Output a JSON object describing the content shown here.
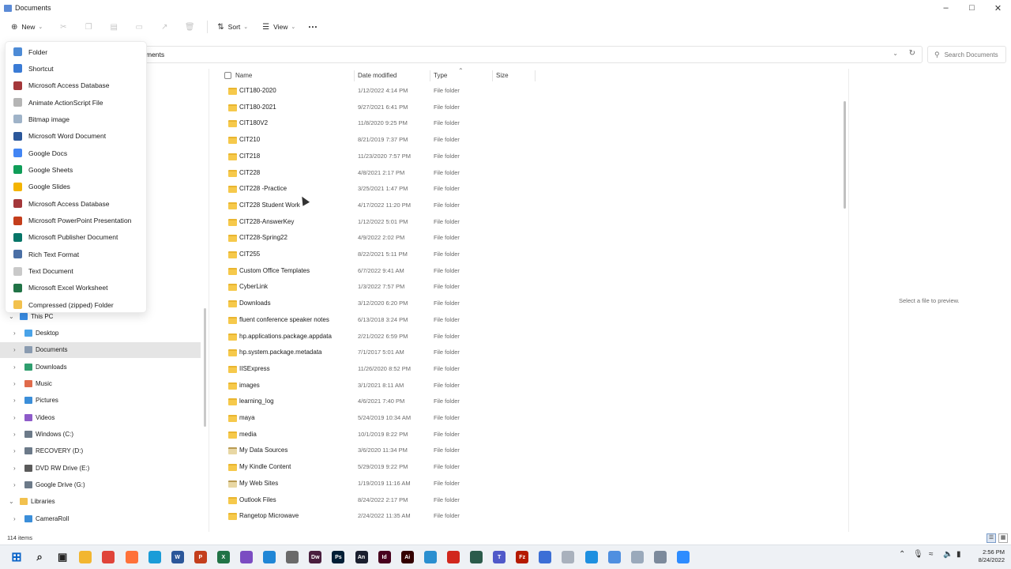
{
  "window": {
    "title": "Documents"
  },
  "toolbar": {
    "new_label": "New",
    "sort_label": "Sort",
    "view_label": "View",
    "more_label": "···"
  },
  "address": {
    "crumb_visible": "ments"
  },
  "search": {
    "placeholder": "Search Documents"
  },
  "new_menu": {
    "items": [
      {
        "label": "Folder",
        "icon": "folder-icon",
        "color": "#4d8bd6"
      },
      {
        "label": "Shortcut",
        "icon": "shortcut-icon",
        "color": "#3a7bd5"
      },
      {
        "label": "Microsoft Access Database",
        "icon": "access-icon",
        "color": "#a4373a"
      },
      {
        "label": "Animate ActionScript File",
        "icon": "script-file-icon",
        "color": "#b5b5b5"
      },
      {
        "label": "Bitmap image",
        "icon": "bitmap-icon",
        "color": "#9fb3c8"
      },
      {
        "label": "Microsoft Word Document",
        "icon": "word-icon",
        "color": "#2b579a"
      },
      {
        "label": "Google Docs",
        "icon": "google-docs-icon",
        "color": "#4285f4"
      },
      {
        "label": "Google Sheets",
        "icon": "google-sheets-icon",
        "color": "#0f9d58"
      },
      {
        "label": "Google Slides",
        "icon": "google-slides-icon",
        "color": "#f4b400"
      },
      {
        "label": "Microsoft Access Database",
        "icon": "access-icon",
        "color": "#a4373a"
      },
      {
        "label": "Microsoft PowerPoint Presentation",
        "icon": "powerpoint-icon",
        "color": "#c43e1c"
      },
      {
        "label": "Microsoft Publisher Document",
        "icon": "publisher-icon",
        "color": "#077568"
      },
      {
        "label": "Rich Text Format",
        "icon": "rtf-icon",
        "color": "#4a6fa5"
      },
      {
        "label": "Text Document",
        "icon": "text-file-icon",
        "color": "#c9c9c9"
      },
      {
        "label": "Microsoft Excel Worksheet",
        "icon": "excel-icon",
        "color": "#217346"
      },
      {
        "label": "Compressed (zipped) Folder",
        "icon": "zip-folder-icon",
        "color": "#f2c14e"
      }
    ]
  },
  "nav": {
    "items": [
      {
        "label": "This PC",
        "icon": "pc-icon",
        "color": "#3a8ee6",
        "level": 0,
        "expanded": true
      },
      {
        "label": "Desktop",
        "icon": "desktop-icon",
        "color": "#4aa3e8",
        "level": 1
      },
      {
        "label": "Documents",
        "icon": "documents-icon",
        "color": "#8a9bb0",
        "level": 1,
        "selected": true
      },
      {
        "label": "Downloads",
        "icon": "downloads-icon",
        "color": "#2f9e6e",
        "level": 1
      },
      {
        "label": "Music",
        "icon": "music-icon",
        "color": "#e06b4b",
        "level": 1
      },
      {
        "label": "Pictures",
        "icon": "pictures-icon",
        "color": "#3b8ed9",
        "level": 1
      },
      {
        "label": "Videos",
        "icon": "videos-icon",
        "color": "#8e5bc9",
        "level": 1
      },
      {
        "label": "Windows (C:)",
        "icon": "drive-icon",
        "color": "#6c7a89",
        "level": 1
      },
      {
        "label": "RECOVERY (D:)",
        "icon": "drive-icon",
        "color": "#6c7a89",
        "level": 1
      },
      {
        "label": "DVD RW Drive (E:)",
        "icon": "dvd-icon",
        "color": "#5a5a5a",
        "level": 1
      },
      {
        "label": "Google Drive (G:)",
        "icon": "drive-icon",
        "color": "#6c7a89",
        "level": 1
      },
      {
        "label": "Libraries",
        "icon": "libraries-icon",
        "color": "#f2c14e",
        "level": 0,
        "expanded": true
      },
      {
        "label": "CameraRoll",
        "icon": "camera-roll-icon",
        "color": "#3b8ed9",
        "level": 1
      }
    ]
  },
  "columns": {
    "name": "Name",
    "date": "Date modified",
    "type": "Type",
    "size": "Size"
  },
  "files": [
    {
      "name": "CIT180-2020",
      "date": "1/12/2022 4:14 PM",
      "type": "File folder"
    },
    {
      "name": "CIT180-2021",
      "date": "9/27/2021 6:41 PM",
      "type": "File folder"
    },
    {
      "name": "CIT180V2",
      "date": "11/8/2020 9:25 PM",
      "type": "File folder"
    },
    {
      "name": "CIT210",
      "date": "8/21/2019 7:37 PM",
      "type": "File folder"
    },
    {
      "name": "CIT218",
      "date": "11/23/2020 7:57 PM",
      "type": "File folder"
    },
    {
      "name": "CIT228",
      "date": "4/8/2021 2:17 PM",
      "type": "File folder"
    },
    {
      "name": "CIT228 -Practice",
      "date": "3/25/2021 1:47 PM",
      "type": "File folder"
    },
    {
      "name": "CIT228 Student Work",
      "date": "4/17/2022 11:20 PM",
      "type": "File folder"
    },
    {
      "name": "CIT228-AnswerKey",
      "date": "1/12/2022 5:01 PM",
      "type": "File folder"
    },
    {
      "name": "CIT228-Spring22",
      "date": "4/9/2022 2:02 PM",
      "type": "File folder"
    },
    {
      "name": "CIT255",
      "date": "8/22/2021 5:11 PM",
      "type": "File folder"
    },
    {
      "name": "Custom Office Templates",
      "date": "6/7/2022 9:41 AM",
      "type": "File folder"
    },
    {
      "name": "CyberLink",
      "date": "1/3/2022 7:57 PM",
      "type": "File folder"
    },
    {
      "name": "Downloads",
      "date": "3/12/2020 6:20 PM",
      "type": "File folder"
    },
    {
      "name": "fluent conference speaker notes",
      "date": "6/13/2018 3:24 PM",
      "type": "File folder"
    },
    {
      "name": "hp.applications.package.appdata",
      "date": "2/21/2022 6:59 PM",
      "type": "File folder"
    },
    {
      "name": "hp.system.package.metadata",
      "date": "7/1/2017 5:01 AM",
      "type": "File folder"
    },
    {
      "name": "IISExpress",
      "date": "11/26/2020 8:52 PM",
      "type": "File folder"
    },
    {
      "name": "images",
      "date": "3/1/2021 8:11 AM",
      "type": "File folder"
    },
    {
      "name": "learning_log",
      "date": "4/6/2021 7:40 PM",
      "type": "File folder"
    },
    {
      "name": "maya",
      "date": "5/24/2019 10:34 AM",
      "type": "File folder"
    },
    {
      "name": "media",
      "date": "10/1/2019 8:22 PM",
      "type": "File folder"
    },
    {
      "name": "My Data Sources",
      "date": "3/6/2020 11:34 PM",
      "type": "File folder",
      "special": true
    },
    {
      "name": "My Kindle Content",
      "date": "5/29/2019 9:22 PM",
      "type": "File folder"
    },
    {
      "name": "My Web Sites",
      "date": "1/19/2019 11:16 AM",
      "type": "File folder",
      "special": true
    },
    {
      "name": "Outlook Files",
      "date": "8/24/2022 2:17 PM",
      "type": "File folder"
    },
    {
      "name": "Rangetop Microwave",
      "date": "2/24/2022 11:35 AM",
      "type": "File folder"
    }
  ],
  "preview": {
    "text": "Select a file to preview."
  },
  "status": {
    "count": "114 items"
  },
  "clock": {
    "time": "2:56 PM",
    "date": "8/24/2022"
  },
  "taskbar": {
    "apps": [
      {
        "name": "start-icon",
        "glyph": "⊞",
        "color": "#0a64c8"
      },
      {
        "name": "search-icon",
        "glyph": "⌕",
        "color": "#222222"
      },
      {
        "name": "task-view-icon",
        "glyph": "▣",
        "color": "#222222"
      },
      {
        "name": "file-explorer-icon",
        "glyph": "",
        "color": "#f2b630"
      },
      {
        "name": "chrome-icon",
        "glyph": "",
        "color": "#e0443a"
      },
      {
        "name": "firefox-icon",
        "glyph": "",
        "color": "#ff7139"
      },
      {
        "name": "edge-icon",
        "glyph": "",
        "color": "#1a9cd8"
      },
      {
        "name": "word-icon",
        "glyph": "W",
        "color": "#2b579a"
      },
      {
        "name": "powerpoint-icon",
        "glyph": "P",
        "color": "#c43e1c"
      },
      {
        "name": "excel-icon",
        "glyph": "X",
        "color": "#217346"
      },
      {
        "name": "visual-studio-icon",
        "glyph": "",
        "color": "#7b4cc2"
      },
      {
        "name": "vscode-icon",
        "glyph": "",
        "color": "#1f86d6"
      },
      {
        "name": "app-icon",
        "glyph": "",
        "color": "#6a6a6a"
      },
      {
        "name": "dreamweaver-icon",
        "glyph": "Dw",
        "color": "#4a1f3f"
      },
      {
        "name": "photoshop-icon",
        "glyph": "Ps",
        "color": "#001e36"
      },
      {
        "name": "animate-icon",
        "glyph": "An",
        "color": "#1a1f2e"
      },
      {
        "name": "indesign-icon",
        "glyph": "Id",
        "color": "#49021f"
      },
      {
        "name": "illustrator-icon",
        "glyph": "Ai",
        "color": "#330000"
      },
      {
        "name": "snipping-tool-icon",
        "glyph": "",
        "color": "#2a8fd0"
      },
      {
        "name": "acrobat-icon",
        "glyph": "",
        "color": "#d1271d"
      },
      {
        "name": "app-icon",
        "glyph": "",
        "color": "#2b5b4b"
      },
      {
        "name": "teams-icon",
        "glyph": "T",
        "color": "#5059c9"
      },
      {
        "name": "filezilla-icon",
        "glyph": "Fz",
        "color": "#b51a00"
      },
      {
        "name": "headset-icon",
        "glyph": "",
        "color": "#3c6fd6"
      },
      {
        "name": "app-icon",
        "glyph": "",
        "color": "#a9b1bd"
      },
      {
        "name": "app-icon",
        "glyph": "",
        "color": "#1e90e0"
      },
      {
        "name": "notepad-icon",
        "glyph": "",
        "color": "#4f8fe0"
      },
      {
        "name": "app-icon",
        "glyph": "",
        "color": "#9aa9bb"
      },
      {
        "name": "app-icon",
        "glyph": "",
        "color": "#7c8a9c"
      },
      {
        "name": "zoom-icon",
        "glyph": "",
        "color": "#2d8cff"
      }
    ]
  }
}
